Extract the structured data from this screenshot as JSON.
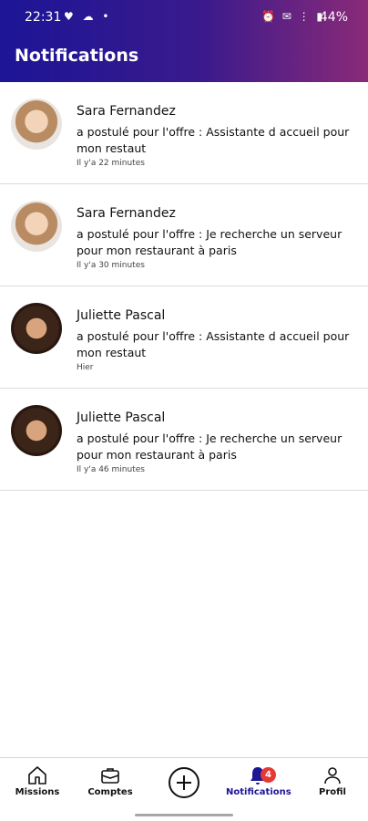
{
  "status_bar": {
    "time": "22:31",
    "left_icons": "♥ ☁ •",
    "right_icons": "⏰ ✉ ⋮ ▮",
    "battery": "44%"
  },
  "header": {
    "title": "Notifications"
  },
  "notifications": [
    {
      "name": "Sara Fernandez",
      "message": "a postulé pour l'offre : Assistante d accueil pour mon restaut",
      "time": "Il y'a 22 minutes",
      "avatar": "light"
    },
    {
      "name": "Sara Fernandez",
      "message": "a postulé pour l'offre : Je recherche un serveur pour mon restaurant à paris",
      "time": "Il y'a 30 minutes",
      "avatar": "light"
    },
    {
      "name": "Juliette Pascal",
      "message": "a postulé pour l'offre : Assistante d accueil pour mon restaut",
      "time": "Hier",
      "avatar": "dark"
    },
    {
      "name": "Juliette Pascal",
      "message": "a postulé pour l'offre : Je recherche un serveur pour mon restaurant à paris",
      "time": "Il y'a 46 minutes",
      "avatar": "dark"
    }
  ],
  "bottom_nav": {
    "missions": "Missions",
    "comptes": "Comptes",
    "notifications": "Notifications",
    "notifications_badge": "4",
    "profil": "Profil"
  },
  "colors": {
    "accent": "#1c1596",
    "header_gradient_end": "#8a2a78",
    "badge": "#e53935"
  }
}
